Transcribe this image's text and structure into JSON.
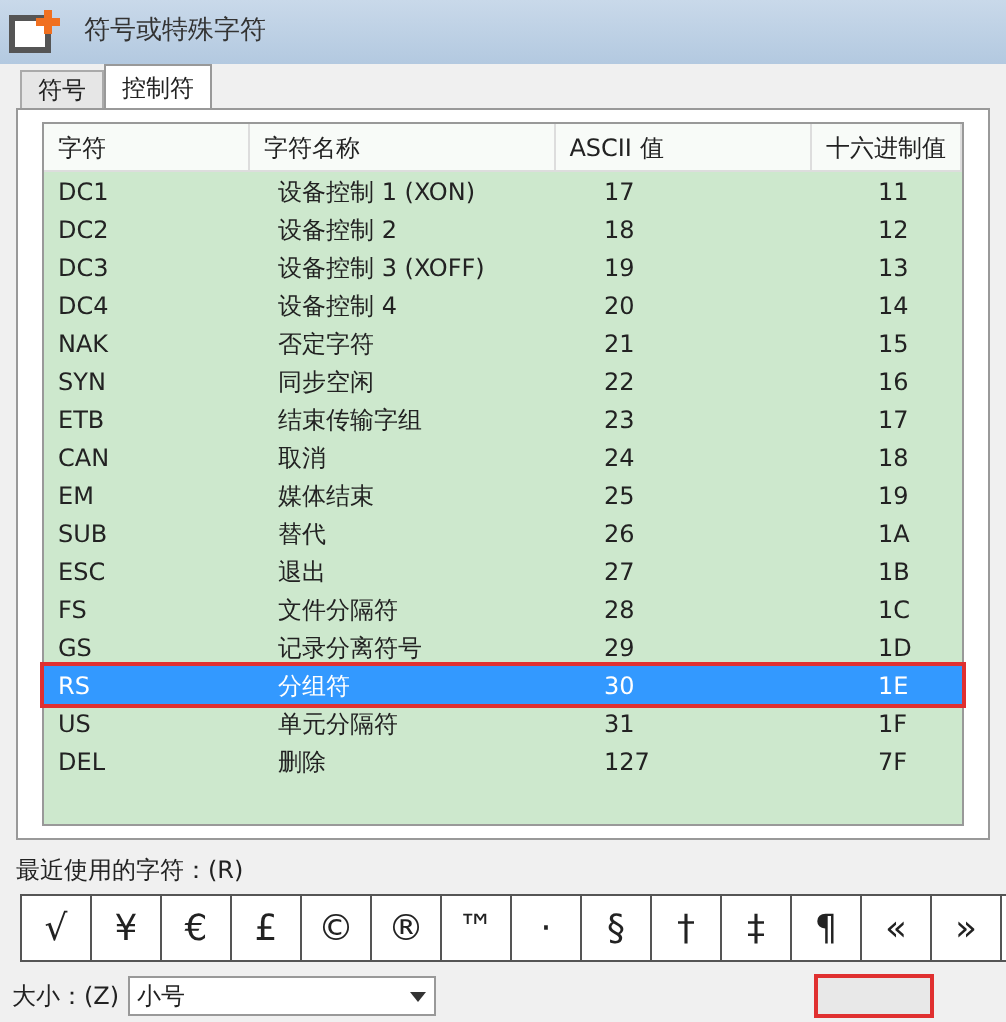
{
  "window": {
    "title": "符号或特殊字符"
  },
  "tabs": [
    {
      "label": "符号",
      "selected": false
    },
    {
      "label": "控制符",
      "selected": true
    }
  ],
  "table": {
    "columns": [
      "字符",
      "字符名称",
      "ASCII 值",
      "十六进制值"
    ],
    "rows": [
      {
        "cells": [
          "DC1",
          "设备控制 1 (XON)",
          "17",
          "11"
        ],
        "selected": false
      },
      {
        "cells": [
          "DC2",
          "设备控制 2",
          "18",
          "12"
        ],
        "selected": false
      },
      {
        "cells": [
          "DC3",
          "设备控制 3 (XOFF)",
          "19",
          "13"
        ],
        "selected": false
      },
      {
        "cells": [
          "DC4",
          "设备控制 4",
          "20",
          "14"
        ],
        "selected": false
      },
      {
        "cells": [
          "NAK",
          "否定字符",
          "21",
          "15"
        ],
        "selected": false
      },
      {
        "cells": [
          "SYN",
          "同步空闲",
          "22",
          "16"
        ],
        "selected": false
      },
      {
        "cells": [
          "ETB",
          "结束传输字组",
          "23",
          "17"
        ],
        "selected": false
      },
      {
        "cells": [
          "CAN",
          "取消",
          "24",
          "18"
        ],
        "selected": false
      },
      {
        "cells": [
          "EM",
          "媒体结束",
          "25",
          "19"
        ],
        "selected": false
      },
      {
        "cells": [
          "SUB",
          "替代",
          "26",
          "1A"
        ],
        "selected": false
      },
      {
        "cells": [
          "ESC",
          "退出",
          "27",
          "1B"
        ],
        "selected": false
      },
      {
        "cells": [
          "FS",
          "文件分隔符",
          "28",
          "1C"
        ],
        "selected": false
      },
      {
        "cells": [
          "GS",
          "记录分离符号",
          "29",
          "1D"
        ],
        "selected": false
      },
      {
        "cells": [
          "RS",
          "分组符",
          "30",
          "1E"
        ],
        "selected": true
      },
      {
        "cells": [
          "US",
          "单元分隔符",
          "31",
          "1F"
        ],
        "selected": false
      },
      {
        "cells": [
          "DEL",
          "删除",
          "127",
          "7F"
        ],
        "selected": false
      }
    ]
  },
  "recent": {
    "label": "最近使用的字符：(R)",
    "chars": [
      "√",
      "¥",
      "€",
      "£",
      "©",
      "®",
      "™",
      "·",
      "§",
      "†",
      "‡",
      "¶",
      "«",
      "»"
    ]
  },
  "size": {
    "label": "大小：(Z)",
    "value": "小号"
  }
}
